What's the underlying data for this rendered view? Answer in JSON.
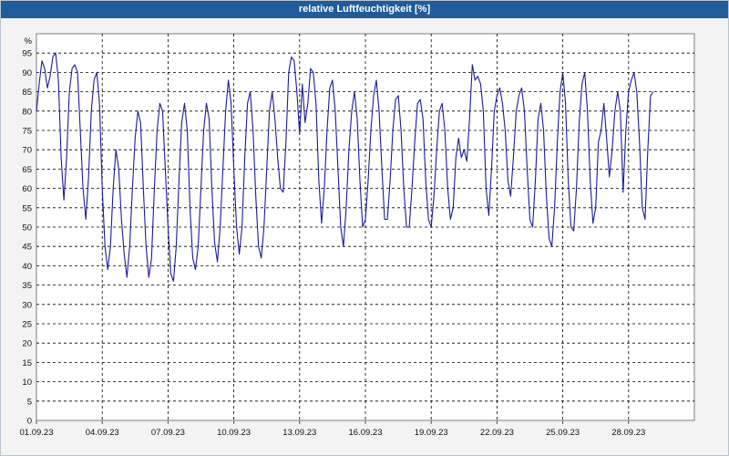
{
  "window": {
    "title": "relative Luftfeuchtigkeit [%]"
  },
  "chart_data": {
    "type": "line",
    "title": "relative Luftfeuchtigkeit [%]",
    "ylabel": "%",
    "xlabel": "",
    "ylim": [
      0,
      100
    ],
    "yticks": [
      0,
      5,
      10,
      15,
      20,
      25,
      30,
      35,
      40,
      45,
      50,
      55,
      60,
      65,
      70,
      75,
      80,
      85,
      90,
      95
    ],
    "xlim": [
      "01.09.23",
      "01.10.23"
    ],
    "xticks": [
      "01.09.23",
      "04.09.23",
      "07.09.23",
      "10.09.23",
      "13.09.23",
      "16.09.23",
      "19.09.23",
      "22.09.23",
      "25.09.23",
      "28.09.23"
    ],
    "grid": true,
    "series": [
      {
        "color": "#1b1b9a",
        "points": [
          [
            "01.09.23 00:00",
            80
          ],
          [
            "01.09.23 03:00",
            87
          ],
          [
            "01.09.23 06:00",
            93
          ],
          [
            "01.09.23 09:00",
            91
          ],
          [
            "01.09.23 12:00",
            86
          ],
          [
            "01.09.23 15:00",
            89
          ],
          [
            "01.09.23 18:00",
            94
          ],
          [
            "01.09.23 21:00",
            95
          ],
          [
            "02.09.23 00:00",
            88
          ],
          [
            "02.09.23 03:00",
            68
          ],
          [
            "02.09.23 06:00",
            57
          ],
          [
            "02.09.23 09:00",
            68
          ],
          [
            "02.09.23 12:00",
            85
          ],
          [
            "02.09.23 15:00",
            91
          ],
          [
            "02.09.23 18:00",
            92
          ],
          [
            "02.09.23 21:00",
            90
          ],
          [
            "03.09.23 00:00",
            75
          ],
          [
            "03.09.23 03:00",
            60
          ],
          [
            "03.09.23 06:00",
            52
          ],
          [
            "03.09.23 09:00",
            63
          ],
          [
            "03.09.23 12:00",
            80
          ],
          [
            "03.09.23 15:00",
            88
          ],
          [
            "03.09.23 18:00",
            90
          ],
          [
            "03.09.23 21:00",
            82
          ],
          [
            "04.09.23 00:00",
            60
          ],
          [
            "04.09.23 03:00",
            45
          ],
          [
            "04.09.23 06:00",
            39
          ],
          [
            "04.09.23 09:00",
            45
          ],
          [
            "04.09.23 12:00",
            60
          ],
          [
            "04.09.23 15:00",
            70
          ],
          [
            "04.09.23 18:00",
            65
          ],
          [
            "04.09.23 21:00",
            52
          ],
          [
            "05.09.23 00:00",
            43
          ],
          [
            "05.09.23 03:00",
            37
          ],
          [
            "05.09.23 06:00",
            45
          ],
          [
            "05.09.23 09:00",
            60
          ],
          [
            "05.09.23 12:00",
            73
          ],
          [
            "05.09.23 15:00",
            80
          ],
          [
            "05.09.23 18:00",
            77
          ],
          [
            "05.09.23 21:00",
            60
          ],
          [
            "06.09.23 00:00",
            45
          ],
          [
            "06.09.23 03:00",
            37
          ],
          [
            "06.09.23 06:00",
            42
          ],
          [
            "06.09.23 09:00",
            60
          ],
          [
            "06.09.23 12:00",
            75
          ],
          [
            "06.09.23 15:00",
            82
          ],
          [
            "06.09.23 18:00",
            80
          ],
          [
            "06.09.23 21:00",
            65
          ],
          [
            "07.09.23 00:00",
            50
          ],
          [
            "07.09.23 03:00",
            38
          ],
          [
            "07.09.23 06:00",
            36
          ],
          [
            "07.09.23 09:00",
            45
          ],
          [
            "07.09.23 12:00",
            62
          ],
          [
            "07.09.23 15:00",
            77
          ],
          [
            "07.09.23 18:00",
            82
          ],
          [
            "07.09.23 21:00",
            75
          ],
          [
            "08.09.23 00:00",
            55
          ],
          [
            "08.09.23 03:00",
            42
          ],
          [
            "08.09.23 06:00",
            39
          ],
          [
            "08.09.23 09:00",
            45
          ],
          [
            "08.09.23 12:00",
            60
          ],
          [
            "08.09.23 15:00",
            75
          ],
          [
            "08.09.23 18:00",
            82
          ],
          [
            "08.09.23 21:00",
            78
          ],
          [
            "09.09.23 00:00",
            60
          ],
          [
            "09.09.23 03:00",
            46
          ],
          [
            "09.09.23 06:00",
            41
          ],
          [
            "09.09.23 09:00",
            50
          ],
          [
            "09.09.23 12:00",
            65
          ],
          [
            "09.09.23 15:00",
            80
          ],
          [
            "09.09.23 18:00",
            88
          ],
          [
            "09.09.23 21:00",
            82
          ],
          [
            "10.09.23 00:00",
            65
          ],
          [
            "10.09.23 03:00",
            50
          ],
          [
            "10.09.23 06:00",
            43
          ],
          [
            "10.09.23 09:00",
            50
          ],
          [
            "10.09.23 12:00",
            68
          ],
          [
            "10.09.23 15:00",
            82
          ],
          [
            "10.09.23 18:00",
            85
          ],
          [
            "10.09.23 21:00",
            75
          ],
          [
            "11.09.23 00:00",
            58
          ],
          [
            "11.09.23 03:00",
            45
          ],
          [
            "11.09.23 06:00",
            42
          ],
          [
            "11.09.23 09:00",
            50
          ],
          [
            "11.09.23 12:00",
            65
          ],
          [
            "11.09.23 15:00",
            80
          ],
          [
            "11.09.23 18:00",
            85
          ],
          [
            "11.09.23 21:00",
            78
          ],
          [
            "12.09.23 00:00",
            68
          ],
          [
            "12.09.23 03:00",
            60
          ],
          [
            "12.09.23 06:00",
            59
          ],
          [
            "12.09.23 09:00",
            72
          ],
          [
            "12.09.23 12:00",
            90
          ],
          [
            "12.09.23 15:00",
            94
          ],
          [
            "12.09.23 18:00",
            93
          ],
          [
            "12.09.23 21:00",
            85
          ],
          [
            "13.09.23 00:00",
            74
          ],
          [
            "13.09.23 03:00",
            87
          ],
          [
            "13.09.23 06:00",
            77
          ],
          [
            "13.09.23 09:00",
            82
          ],
          [
            "13.09.23 12:00",
            91
          ],
          [
            "13.09.23 15:00",
            90
          ],
          [
            "13.09.23 18:00",
            82
          ],
          [
            "13.09.23 21:00",
            62
          ],
          [
            "14.09.23 00:00",
            51
          ],
          [
            "14.09.23 03:00",
            60
          ],
          [
            "14.09.23 06:00",
            75
          ],
          [
            "14.09.23 09:00",
            86
          ],
          [
            "14.09.23 12:00",
            88
          ],
          [
            "14.09.23 15:00",
            80
          ],
          [
            "14.09.23 18:00",
            65
          ],
          [
            "14.09.23 21:00",
            50
          ],
          [
            "15.09.23 00:00",
            45
          ],
          [
            "15.09.23 03:00",
            55
          ],
          [
            "15.09.23 06:00",
            70
          ],
          [
            "15.09.23 09:00",
            80
          ],
          [
            "15.09.23 12:00",
            85
          ],
          [
            "15.09.23 15:00",
            78
          ],
          [
            "15.09.23 18:00",
            62
          ],
          [
            "15.09.23 21:00",
            50
          ],
          [
            "16.09.23 00:00",
            52
          ],
          [
            "16.09.23 03:00",
            62
          ],
          [
            "16.09.23 06:00",
            75
          ],
          [
            "16.09.23 09:00",
            84
          ],
          [
            "16.09.23 12:00",
            88
          ],
          [
            "16.09.23 15:00",
            80
          ],
          [
            "16.09.23 18:00",
            65
          ],
          [
            "16.09.23 21:00",
            52
          ],
          [
            "17.09.23 00:00",
            52
          ],
          [
            "17.09.23 03:00",
            62
          ],
          [
            "17.09.23 06:00",
            75
          ],
          [
            "17.09.23 09:00",
            83
          ],
          [
            "17.09.23 12:00",
            84
          ],
          [
            "17.09.23 15:00",
            75
          ],
          [
            "17.09.23 18:00",
            60
          ],
          [
            "17.09.23 21:00",
            50
          ],
          [
            "18.09.23 00:00",
            50
          ],
          [
            "18.09.23 03:00",
            60
          ],
          [
            "18.09.23 06:00",
            72
          ],
          [
            "18.09.23 09:00",
            82
          ],
          [
            "18.09.23 12:00",
            83
          ],
          [
            "18.09.23 15:00",
            78
          ],
          [
            "18.09.23 18:00",
            62
          ],
          [
            "18.09.23 21:00",
            52
          ],
          [
            "19.09.23 00:00",
            50
          ],
          [
            "19.09.23 03:00",
            58
          ],
          [
            "19.09.23 06:00",
            70
          ],
          [
            "19.09.23 09:00",
            80
          ],
          [
            "19.09.23 12:00",
            82
          ],
          [
            "19.09.23 15:00",
            75
          ],
          [
            "19.09.23 18:00",
            60
          ],
          [
            "19.09.23 21:00",
            52
          ],
          [
            "20.09.23 00:00",
            55
          ],
          [
            "20.09.23 03:00",
            68
          ],
          [
            "20.09.23 06:00",
            73
          ],
          [
            "20.09.23 09:00",
            68
          ],
          [
            "20.09.23 12:00",
            70
          ],
          [
            "20.09.23 15:00",
            67
          ],
          [
            "20.09.23 18:00",
            78
          ],
          [
            "20.09.23 21:00",
            92
          ],
          [
            "21.09.23 00:00",
            88
          ],
          [
            "21.09.23 03:00",
            89
          ],
          [
            "21.09.23 06:00",
            87
          ],
          [
            "21.09.23 09:00",
            80
          ],
          [
            "21.09.23 12:00",
            60
          ],
          [
            "21.09.23 15:00",
            53
          ],
          [
            "21.09.23 18:00",
            65
          ],
          [
            "21.09.23 21:00",
            80
          ],
          [
            "22.09.23 00:00",
            84
          ],
          [
            "22.09.23 03:00",
            86
          ],
          [
            "22.09.23 06:00",
            82
          ],
          [
            "22.09.23 09:00",
            75
          ],
          [
            "22.09.23 12:00",
            62
          ],
          [
            "22.09.23 15:00",
            58
          ],
          [
            "22.09.23 18:00",
            68
          ],
          [
            "22.09.23 21:00",
            80
          ],
          [
            "23.09.23 00:00",
            84
          ],
          [
            "23.09.23 03:00",
            86
          ],
          [
            "23.09.23 06:00",
            80
          ],
          [
            "23.09.23 09:00",
            65
          ],
          [
            "23.09.23 12:00",
            52
          ],
          [
            "23.09.23 15:00",
            50
          ],
          [
            "23.09.23 18:00",
            62
          ],
          [
            "23.09.23 21:00",
            78
          ],
          [
            "24.09.23 00:00",
            82
          ],
          [
            "24.09.23 03:00",
            75
          ],
          [
            "24.09.23 06:00",
            58
          ],
          [
            "24.09.23 09:00",
            47
          ],
          [
            "24.09.23 12:00",
            45
          ],
          [
            "24.09.23 15:00",
            55
          ],
          [
            "24.09.23 18:00",
            72
          ],
          [
            "24.09.23 21:00",
            85
          ],
          [
            "25.09.23 00:00",
            90
          ],
          [
            "25.09.23 03:00",
            82
          ],
          [
            "25.09.23 06:00",
            62
          ],
          [
            "25.09.23 09:00",
            50
          ],
          [
            "25.09.23 12:00",
            49
          ],
          [
            "25.09.23 15:00",
            60
          ],
          [
            "25.09.23 18:00",
            77
          ],
          [
            "25.09.23 21:00",
            87
          ],
          [
            "26.09.23 00:00",
            90
          ],
          [
            "26.09.23 03:00",
            80
          ],
          [
            "26.09.23 06:00",
            62
          ],
          [
            "26.09.23 09:00",
            51
          ],
          [
            "26.09.23 12:00",
            55
          ],
          [
            "26.09.23 15:00",
            72
          ],
          [
            "26.09.23 18:00",
            75
          ],
          [
            "26.09.23 21:00",
            82
          ],
          [
            "27.09.23 00:00",
            73
          ],
          [
            "27.09.23 03:00",
            63
          ],
          [
            "27.09.23 06:00",
            70
          ],
          [
            "27.09.23 09:00",
            80
          ],
          [
            "27.09.23 12:00",
            85
          ],
          [
            "27.09.23 15:00",
            80
          ],
          [
            "27.09.23 18:00",
            59
          ],
          [
            "27.09.23 21:00",
            75
          ],
          [
            "28.09.23 00:00",
            85
          ],
          [
            "28.09.23 03:00",
            88
          ],
          [
            "28.09.23 06:00",
            90
          ],
          [
            "28.09.23 09:00",
            85
          ],
          [
            "28.09.23 12:00",
            72
          ],
          [
            "28.09.23 15:00",
            55
          ],
          [
            "28.09.23 18:00",
            52
          ],
          [
            "28.09.23 21:00",
            70
          ],
          [
            "29.09.23 00:00",
            84
          ],
          [
            "29.09.23 03:00",
            85
          ]
        ]
      }
    ]
  }
}
